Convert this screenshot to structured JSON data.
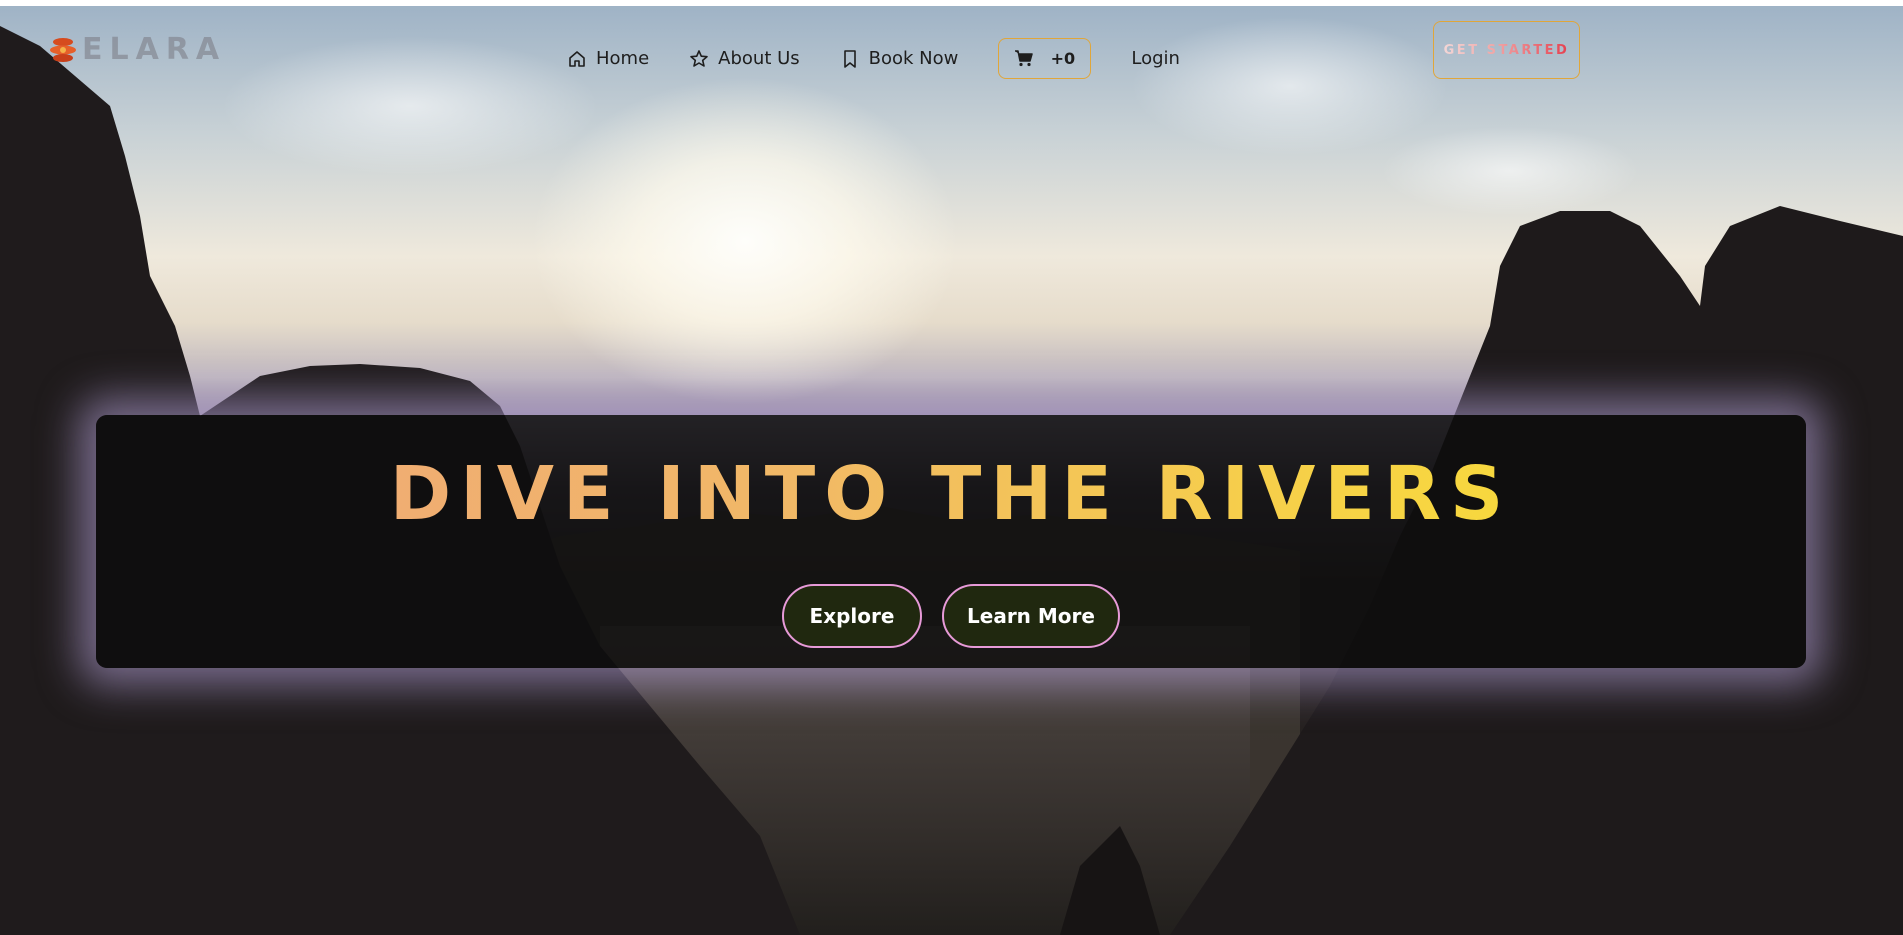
{
  "brand": {
    "name": "ELARA"
  },
  "nav": {
    "items": [
      {
        "label": "Home",
        "icon": "home-icon"
      },
      {
        "label": "About Us",
        "icon": "star-icon"
      },
      {
        "label": "Book Now",
        "icon": "bookmark-icon"
      }
    ],
    "cart": {
      "icon": "cart-icon",
      "count": "+0"
    },
    "login": "Login"
  },
  "cta": {
    "get_started": "GET STARTED"
  },
  "hero": {
    "title": "DIVE INTO THE RIVERS",
    "buttons": {
      "explore": "Explore",
      "learn_more": "Learn More"
    }
  },
  "colors": {
    "accent_border": "#e0a63a",
    "button_border": "#e79ad8",
    "button_bg": "#20280f",
    "title_gradient_start": "#f0a57a",
    "title_gradient_end": "#f8e02f"
  }
}
